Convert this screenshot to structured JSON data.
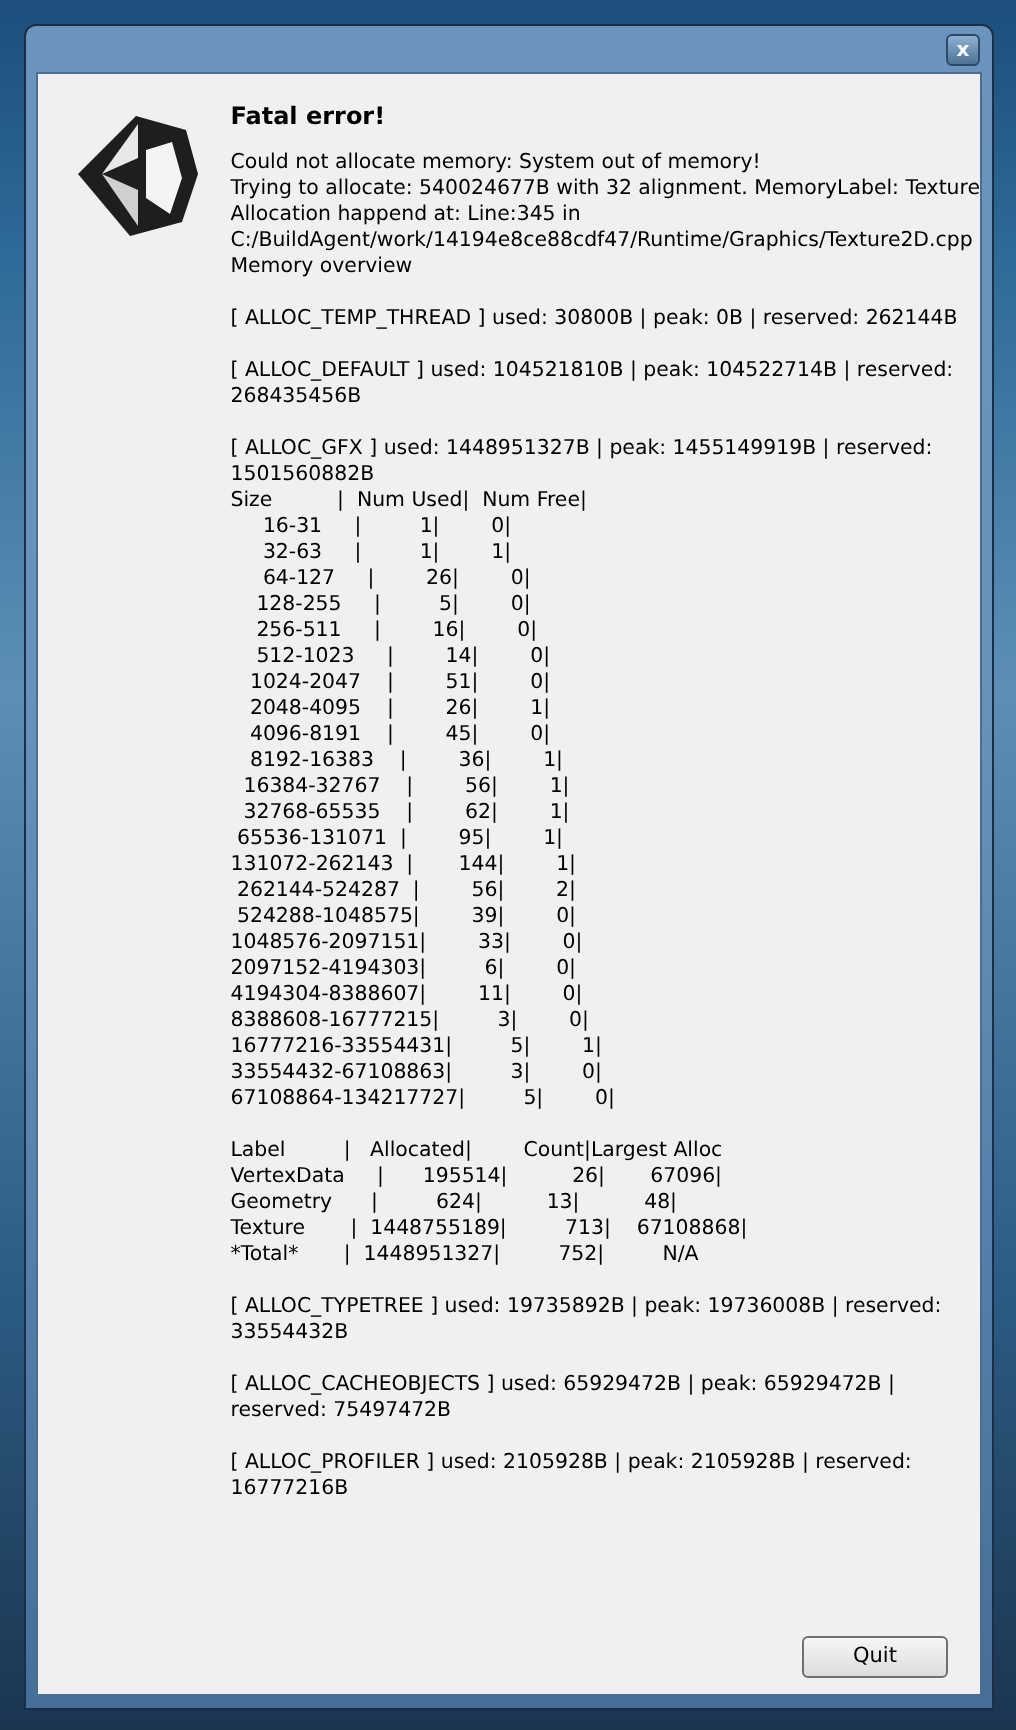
{
  "window": {
    "close_label": "x"
  },
  "dialog": {
    "title": "Fatal error!",
    "paragraphs": [
      [
        "Could not allocate memory: System out of memory!",
        "Trying to allocate: 540024677B with 32 alignment. MemoryLabel: Texture",
        "Allocation happend at: Line:345 in",
        "C:/BuildAgent/work/14194e8ce88cdf47/Runtime/Graphics/Texture2D.cpp",
        "Memory overview"
      ],
      [
        "[ ALLOC_TEMP_THREAD ] used: 30800B | peak: 0B | reserved: 262144B"
      ],
      [
        "[ ALLOC_DEFAULT ] used: 104521810B | peak: 104522714B | reserved:",
        "268435456B"
      ],
      [
        "[ ALLOC_GFX ] used: 1448951327B | peak: 1455149919B | reserved:",
        "1501560882B",
        "Size          |  Num Used|  Num Free|",
        "     16-31     |         1|        0|",
        "     32-63     |         1|        1|",
        "     64-127     |        26|        0|",
        "    128-255     |         5|        0|",
        "    256-511     |        16|        0|",
        "    512-1023     |        14|        0|",
        "   1024-2047    |        51|        0|",
        "   2048-4095    |        26|        1|",
        "   4096-8191    |        45|        0|",
        "   8192-16383    |        36|        1|",
        "  16384-32767    |        56|        1|",
        "  32768-65535    |        62|        1|",
        " 65536-131071  |        95|        1|",
        "131072-262143  |       144|        1|",
        " 262144-524287  |        56|        2|",
        " 524288-1048575|        39|        0|",
        "1048576-2097151|        33|        0|",
        "2097152-4194303|         6|        0|",
        "4194304-8388607|        11|        0|",
        "8388608-16777215|         3|        0|",
        "16777216-33554431|         5|        1|",
        "33554432-67108863|         3|        0|",
        "67108864-134217727|         5|        0|"
      ],
      [
        "Label         |   Allocated|        Count|Largest Alloc",
        "VertexData     |      195514|          26|       67096|",
        "Geometry      |         624|          13|          48|",
        "Texture       |  1448755189|         713|    67108868|",
        "*Total*       |  1448951327|         752|         N/A"
      ],
      [
        "[ ALLOC_TYPETREE ] used: 19735892B | peak: 19736008B | reserved:",
        "33554432B"
      ],
      [
        "[ ALLOC_CACHEOBJECTS ] used: 65929472B | peak: 65929472B |",
        "reserved: 75497472B"
      ],
      [
        "[ ALLOC_PROFILER ] used: 2105928B | peak: 2105928B | reserved:",
        "16777216B"
      ]
    ],
    "buttons": [
      "Quit"
    ]
  }
}
